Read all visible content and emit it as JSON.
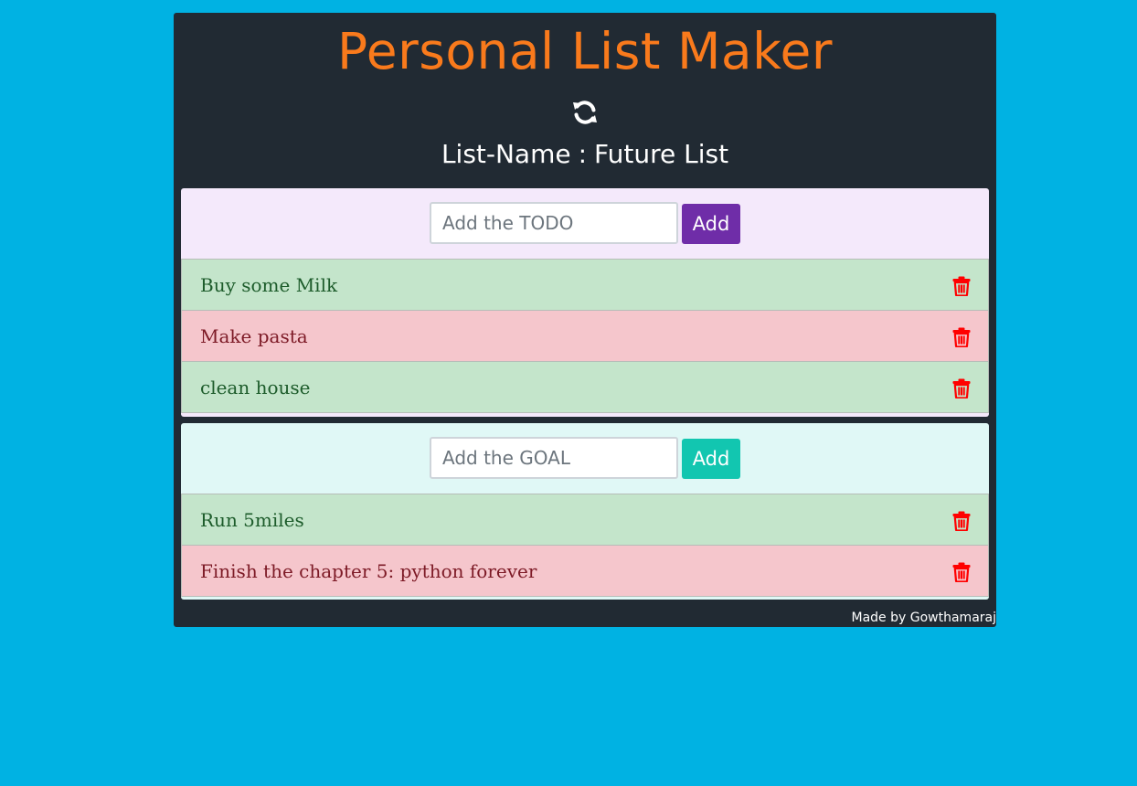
{
  "app": {
    "title": "Personal List Maker",
    "refresh_icon": "refresh-icon",
    "list_name_label": "List-Name",
    "list_name_separator": ":",
    "list_name_value": "Future List",
    "footer": "Made by Gowthamaraj"
  },
  "todo": {
    "placeholder": "Add the TODO",
    "add_label": "Add",
    "button_color": "#6f2da8",
    "items": [
      {
        "text": "Buy some Milk",
        "status": "green"
      },
      {
        "text": "Make pasta",
        "status": "red"
      },
      {
        "text": "clean house",
        "status": "green"
      }
    ]
  },
  "goal": {
    "placeholder": "Add the GOAL",
    "add_label": "Add",
    "button_color": "#12c6b0",
    "items": [
      {
        "text": "Run 5miles",
        "status": "green"
      },
      {
        "text": "Finish the chapter 5: python forever",
        "status": "red"
      }
    ]
  },
  "colors": {
    "background": "#00b2e3",
    "card": "#212a33",
    "title": "#f97a1c",
    "trash": "#ff0000",
    "item_green": "#c4e5cb",
    "item_red": "#f5c6cc"
  },
  "icons": {
    "delete": "trash-icon"
  }
}
